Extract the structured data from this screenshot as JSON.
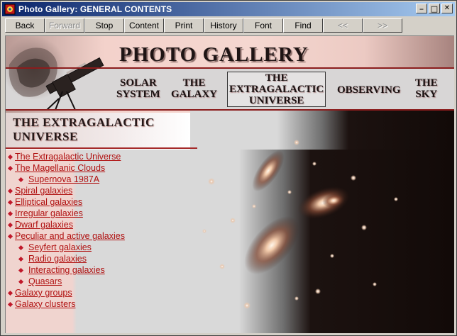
{
  "window": {
    "title": "Photo Gallery: GENERAL CONTENTS",
    "controls": {
      "minimize": "_",
      "maximize": "□",
      "close": "✕"
    }
  },
  "toolbar": {
    "buttons": [
      {
        "label": "Back",
        "enabled": true
      },
      {
        "label": "Forward",
        "enabled": false
      },
      {
        "label": "Stop",
        "enabled": true
      },
      {
        "label": "Content",
        "enabled": true
      },
      {
        "label": "Print",
        "enabled": true
      },
      {
        "label": "History",
        "enabled": true
      },
      {
        "label": "Font",
        "enabled": true
      },
      {
        "label": "Find",
        "enabled": true
      },
      {
        "label": "<<",
        "enabled": false
      },
      {
        "label": ">>",
        "enabled": false
      }
    ]
  },
  "banner": {
    "title": "PHOTO GALLERY",
    "nav": [
      {
        "line1": "SOLAR",
        "line2": "SYSTEM"
      },
      {
        "line1": "THE",
        "line2": "GALAXY"
      },
      {
        "line1": "THE",
        "line2": "EXTRAGALACTIC",
        "line3": "UNIVERSE",
        "active": true
      },
      {
        "line1": "OBSERVING"
      },
      {
        "line1": "THE",
        "line2": "SKY"
      }
    ]
  },
  "section": {
    "title_line1": "THE EXTRAGALACTIC",
    "title_line2": "UNIVERSE"
  },
  "toc": [
    {
      "label": "The Extragalactic Universe",
      "level": 0
    },
    {
      "label": "The Magellanic Clouds",
      "level": 0
    },
    {
      "label": "Supernova 1987A",
      "level": 1
    },
    {
      "label": "Spiral galaxies",
      "level": 0
    },
    {
      "label": "Elliptical galaxies",
      "level": 0
    },
    {
      "label": "Irregular galaxies",
      "level": 0
    },
    {
      "label": "Dwarf galaxies",
      "level": 0
    },
    {
      "label": "Peculiar and active galaxies",
      "level": 0
    },
    {
      "label": "Seyfert galaxies",
      "level": 1
    },
    {
      "label": "Radio galaxies",
      "level": 1
    },
    {
      "label": "Interacting galaxies",
      "level": 1
    },
    {
      "label": "Quasars",
      "level": 1
    },
    {
      "label": "Galaxy groups",
      "level": 0
    },
    {
      "label": "Galaxy clusters",
      "level": 0
    }
  ],
  "colors": {
    "link": "#b01010",
    "bullet": "#c0182a",
    "title_bar_start": "#0a246a",
    "title_bar_end": "#a6caf0"
  }
}
